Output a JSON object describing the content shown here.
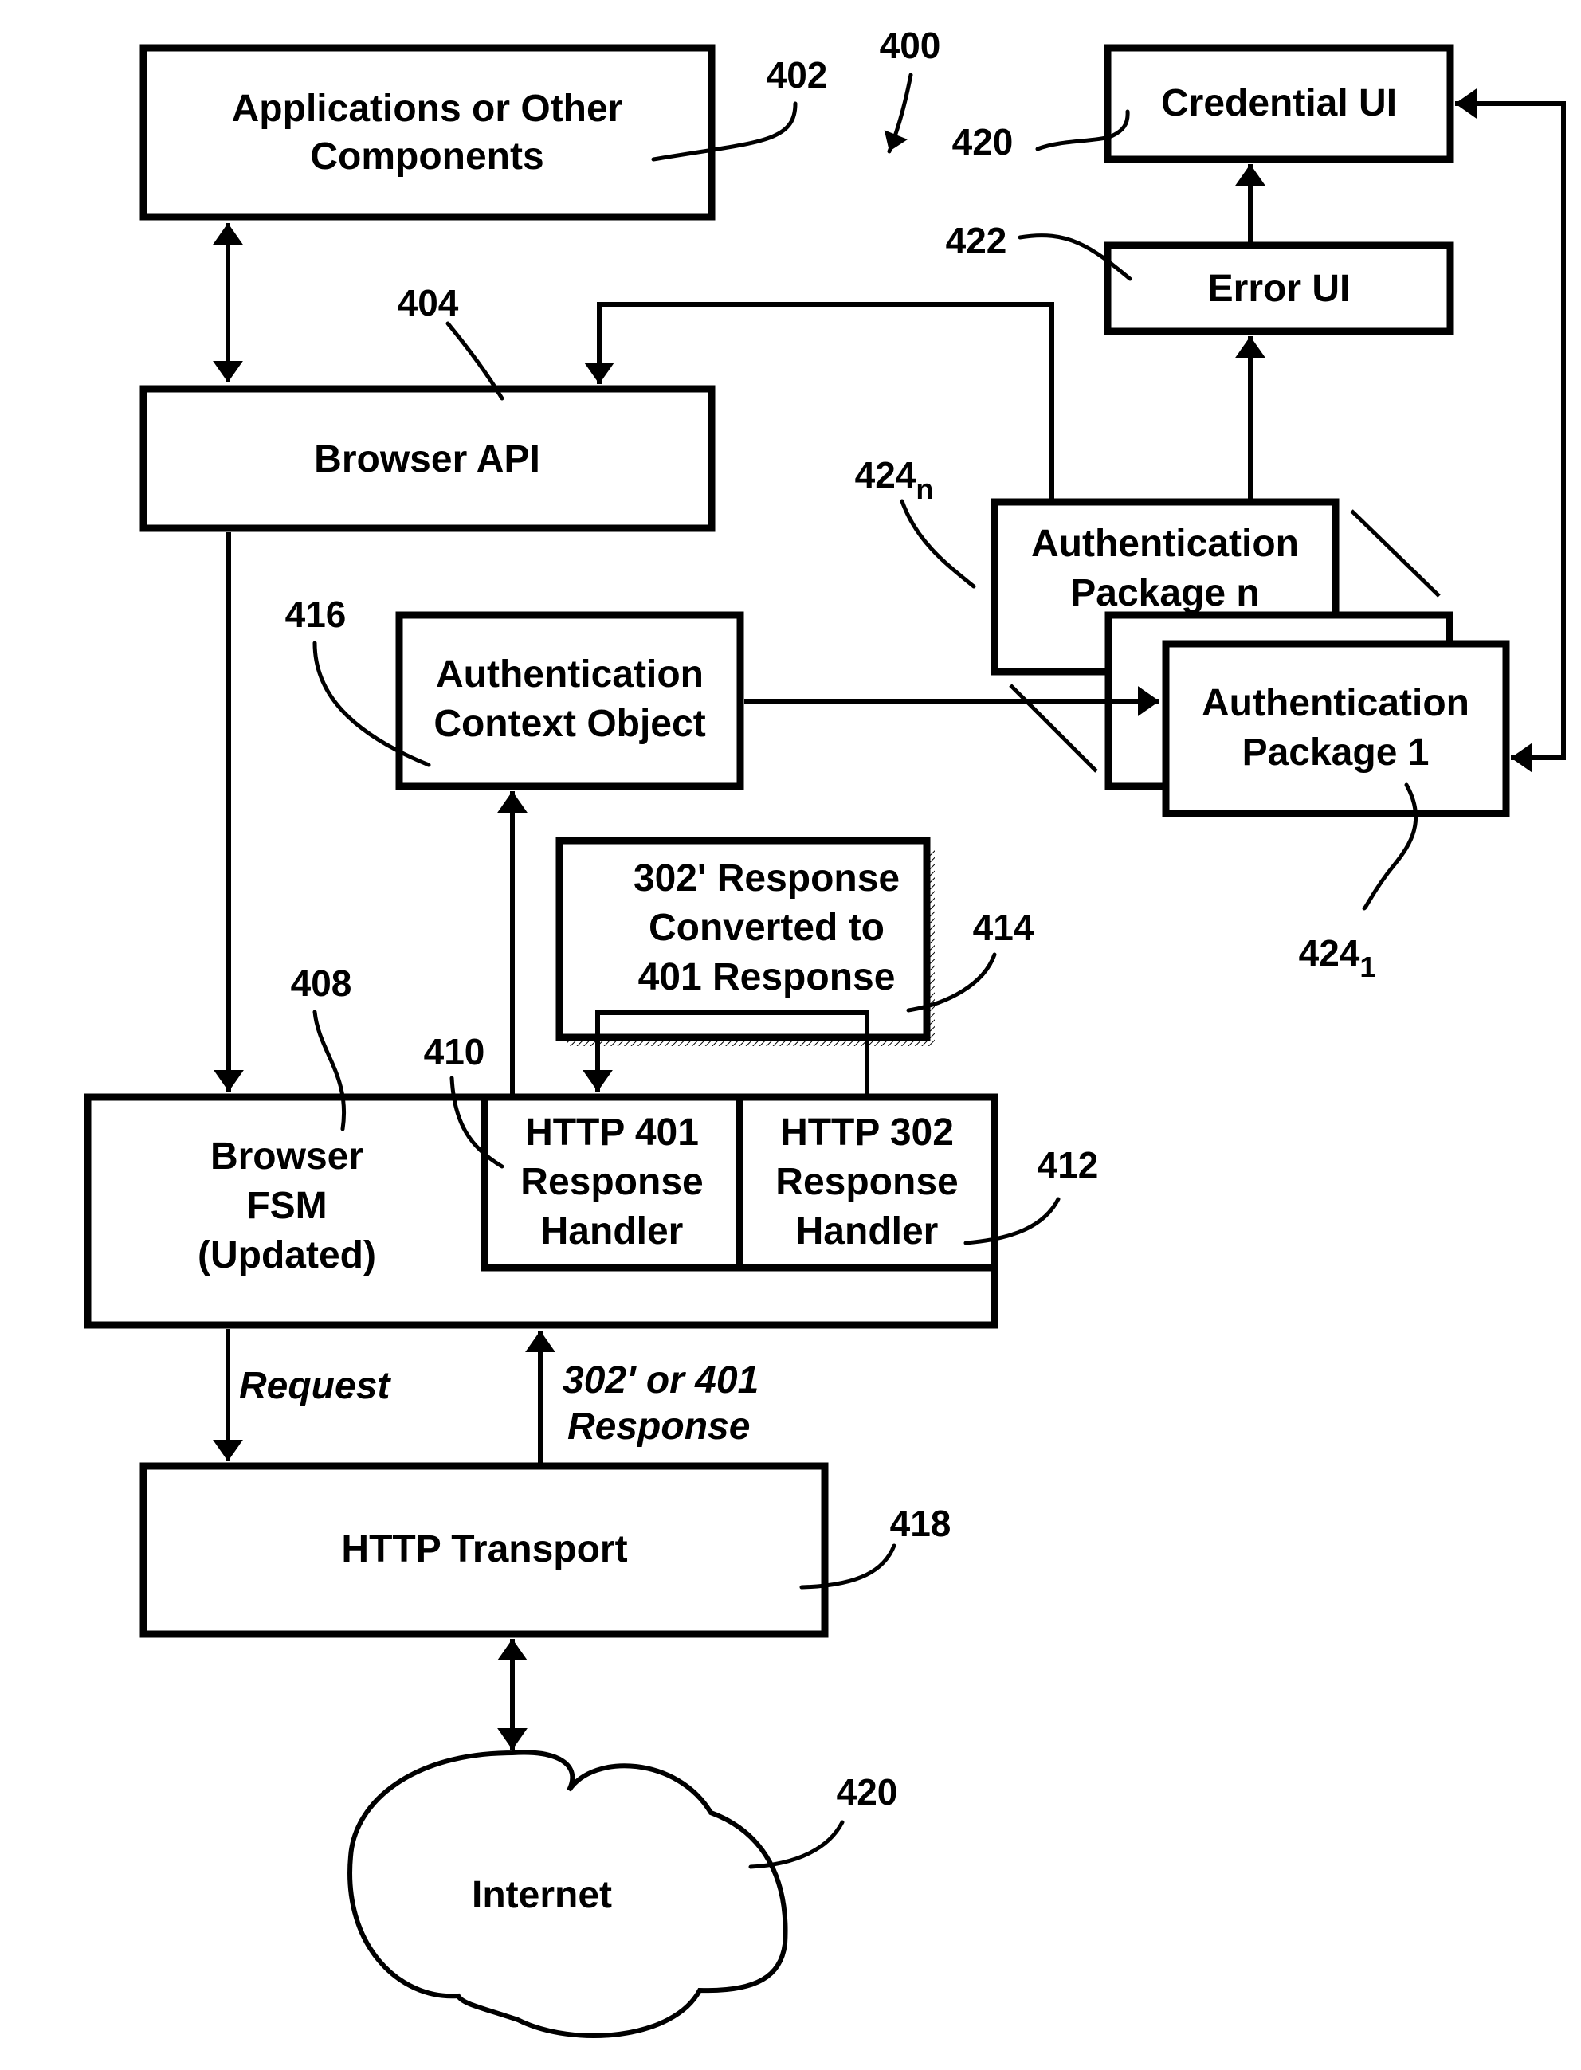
{
  "figure": {
    "ref": "400",
    "colors": {
      "ink": "#000000",
      "paper": "#ffffff"
    }
  },
  "boxes": {
    "applications": {
      "lines": [
        "Applications or Other",
        "Components"
      ],
      "ref": "402"
    },
    "browser_api": {
      "lines": [
        "Browser API"
      ],
      "ref": "404"
    },
    "auth_context": {
      "lines": [
        "Authentication",
        "Context Object"
      ],
      "ref": "416"
    },
    "converted_response": {
      "lines": [
        "302' Response",
        "Converted to",
        "401 Response"
      ],
      "ref": "414"
    },
    "browser_fsm": {
      "lines": [
        "Browser",
        "FSM",
        "(Updated)"
      ],
      "ref": "408"
    },
    "handler_401": {
      "lines": [
        "HTTP 401",
        "Response",
        "Handler"
      ],
      "ref": "410"
    },
    "handler_302": {
      "lines": [
        "HTTP 302",
        "Response",
        "Handler"
      ],
      "ref": "412"
    },
    "http_transport": {
      "lines": [
        "HTTP Transport"
      ],
      "ref": "418"
    },
    "internet": {
      "lines": [
        "Internet"
      ],
      "ref": "420"
    },
    "credential_ui": {
      "lines": [
        "Credential UI"
      ],
      "ref": "420"
    },
    "error_ui": {
      "lines": [
        "Error UI"
      ],
      "ref": "422"
    },
    "auth_package_n": {
      "lines": [
        "Authentication",
        "Package n"
      ],
      "ref": "424",
      "ref_sub": "n"
    },
    "auth_package_1": {
      "lines": [
        "Authentication",
        "Package 1"
      ],
      "ref": "424",
      "ref_sub": "1"
    }
  },
  "edges": {
    "request": "Request",
    "response": [
      "302' or 401",
      "Response"
    ]
  }
}
